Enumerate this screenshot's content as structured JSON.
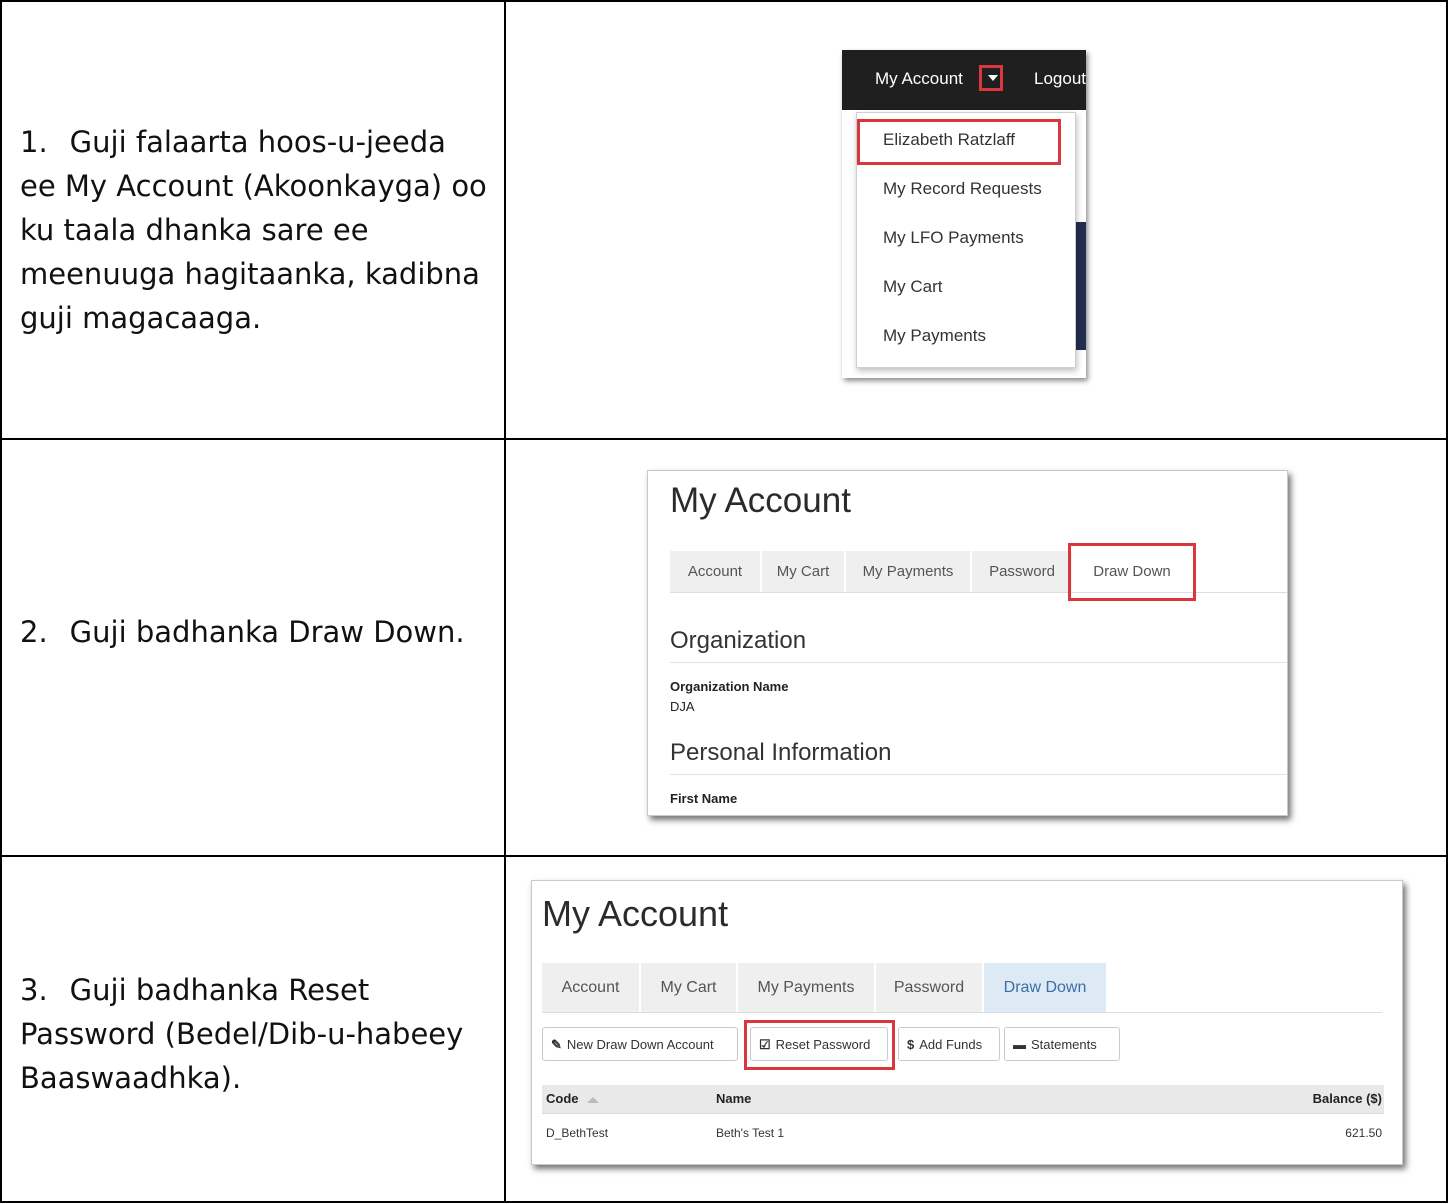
{
  "steps": [
    {
      "number": "1.",
      "text": "Guji falaarta hoos-u-jeeda ee My Account (Akoonkayga) oo ku taala dhanka sare ee meenuuga hagitaanka, kadibna guji magacaaga."
    },
    {
      "number": "2.",
      "text": "Guji badhanka Draw Down."
    },
    {
      "number": "3.",
      "text": "Guji badhanka Reset Password (Bedel/Dib-u-habeey Baaswaadhka)."
    }
  ],
  "screenshot1": {
    "nav_account": "My Account",
    "nav_logout": "Logout",
    "menu_items": [
      "Elizabeth Ratzlaff",
      "My Record Requests",
      "My LFO Payments",
      "My Cart",
      "My Payments"
    ]
  },
  "screenshot2": {
    "title": "My Account",
    "tabs": [
      "Account",
      "My Cart",
      "My Payments",
      "Password",
      "Draw Down"
    ],
    "section1": "Organization",
    "org_label": "Organization Name",
    "org_value": "DJA",
    "section2": "Personal Information",
    "first_name_label": "First Name"
  },
  "screenshot3": {
    "title": "My Account",
    "tabs": [
      "Account",
      "My Cart",
      "My Payments",
      "Password",
      "Draw Down"
    ],
    "buttons": [
      "New Draw Down Account",
      "Reset Password",
      "Add Funds",
      "Statements"
    ],
    "columns": [
      "Code",
      "Name",
      "Balance ($)"
    ],
    "rows": [
      {
        "code": "D_BethTest",
        "name": "Beth's Test 1",
        "balance": "621.50"
      }
    ]
  },
  "colors": {
    "highlight": "#d9363e",
    "navbar": "#1f1f1f",
    "active_tab": "#dde9f5"
  }
}
